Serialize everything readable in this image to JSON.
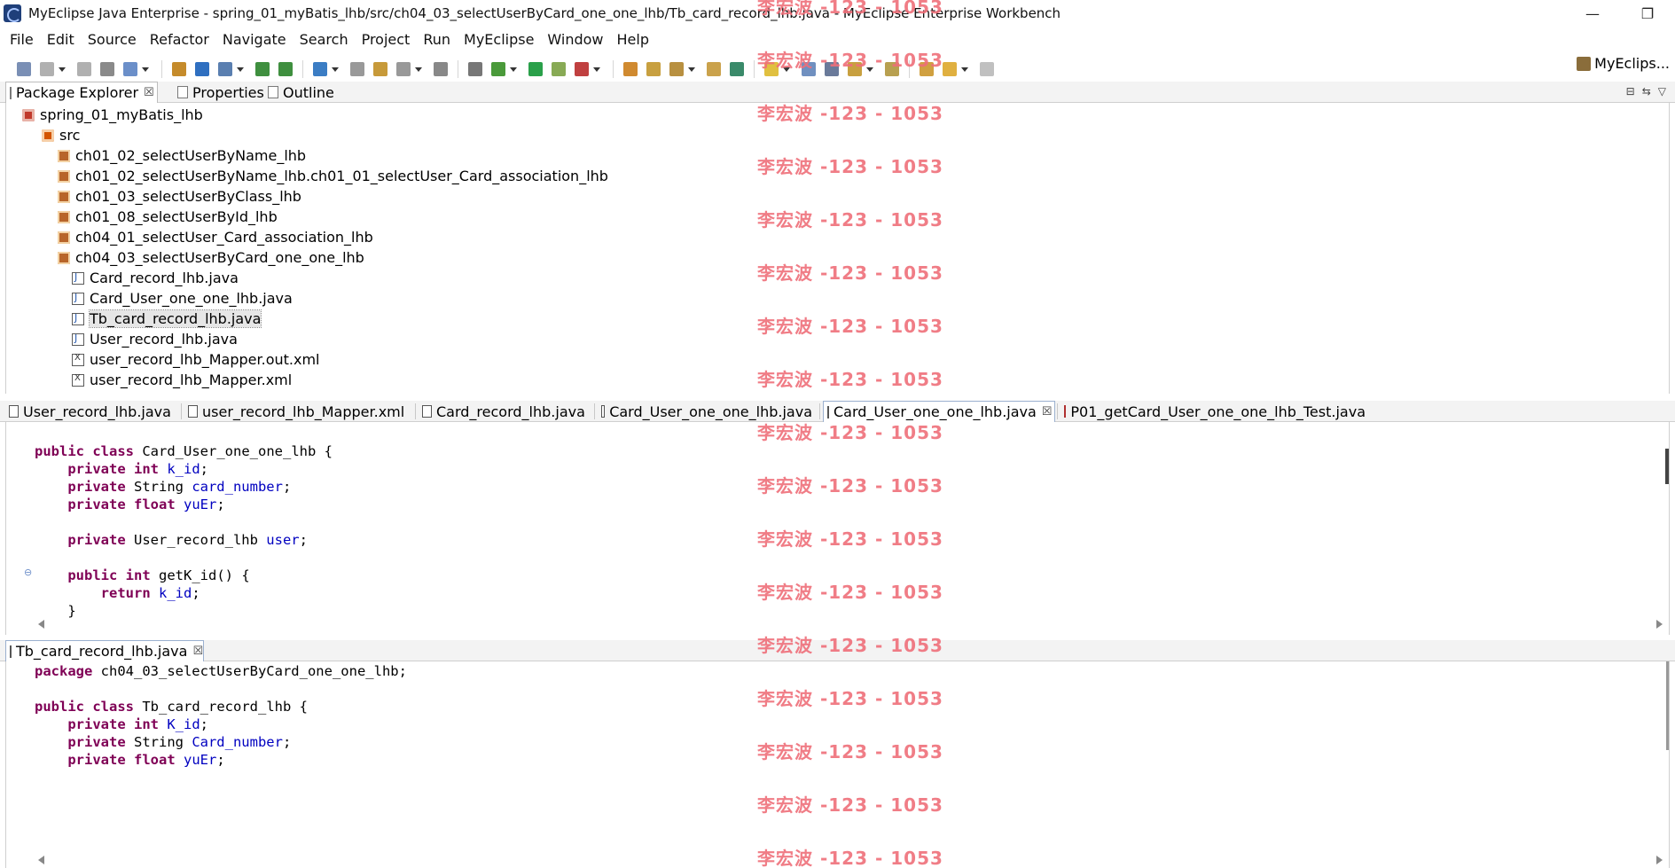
{
  "window": {
    "title": "MyEclipse Java Enterprise - spring_01_myBatis_lhb/src/ch04_03_selectUserByCard_one_one_lhb/Tb_card_record_lhb.java - MyEclipse Enterprise Workbench",
    "minimize": "—",
    "restore": "❐"
  },
  "menu": [
    "File",
    "Edit",
    "Source",
    "Refactor",
    "Navigate",
    "Search",
    "Project",
    "Run",
    "MyEclipse",
    "Window",
    "Help"
  ],
  "perspective": {
    "label": "MyEclips..."
  },
  "top_views": {
    "tabs": [
      {
        "label": "Package Explorer",
        "close": "☒",
        "active": true
      },
      {
        "label": "Properties"
      },
      {
        "label": "Outline"
      }
    ]
  },
  "tree": [
    {
      "label": "spring_01_myBatis_lhb",
      "icon": "project-icon",
      "level": 0
    },
    {
      "label": "src",
      "icon": "source-folder-icon",
      "level": 1
    },
    {
      "label": "ch01_02_selectUserByName_lhb",
      "icon": "package-icon",
      "level": 2
    },
    {
      "label": "ch01_02_selectUserByName_lhb.ch01_01_selectUser_Card_association_lhb",
      "icon": "package-icon",
      "level": 2
    },
    {
      "label": "ch01_03_selectUserByClass_lhb",
      "icon": "package-icon",
      "level": 2
    },
    {
      "label": "ch01_08_selectUserById_lhb",
      "icon": "package-icon",
      "level": 2
    },
    {
      "label": "ch04_01_selectUser_Card_association_lhb",
      "icon": "package-icon",
      "level": 2
    },
    {
      "label": "ch04_03_selectUserByCard_one_one_lhb",
      "icon": "package-icon",
      "level": 2
    },
    {
      "label": "Card_record_lhb.java",
      "icon": "java-file-icon",
      "level": 3
    },
    {
      "label": "Card_User_one_one_lhb.java",
      "icon": "java-file-icon",
      "level": 3
    },
    {
      "label": "Tb_card_record_lhb.java",
      "icon": "java-file-icon",
      "level": 3,
      "selected": true
    },
    {
      "label": "User_record_lhb.java",
      "icon": "java-file-icon",
      "level": 3
    },
    {
      "label": "user_record_lhb_Mapper.out.xml",
      "icon": "xml-file-icon",
      "level": 3
    },
    {
      "label": "user_record_lhb_Mapper.xml",
      "icon": "xml-file-icon",
      "level": 3
    }
  ],
  "editor_tabs": [
    {
      "label": "User_record_lhb.java",
      "type": "java"
    },
    {
      "label": "user_record_lhb_Mapper.xml",
      "type": "xml"
    },
    {
      "label": "Card_record_lhb.java",
      "type": "java"
    },
    {
      "label": "Card_User_one_one_lhb.java",
      "type": "java"
    },
    {
      "label": "Card_User_one_one_lhb.java",
      "type": "java",
      "active": true,
      "close": "☒"
    },
    {
      "label": "P01_getCard_User_one_one_lhb_Test.java",
      "type": "test"
    }
  ],
  "editor1": {
    "lines": [
      [
        {
          "t": "public",
          "c": "kw"
        },
        {
          "t": " "
        },
        {
          "t": "class",
          "c": "kw"
        },
        {
          "t": " Card_User_one_one_lhb {"
        }
      ],
      [
        {
          "t": "    "
        },
        {
          "t": "private",
          "c": "kw"
        },
        {
          "t": " "
        },
        {
          "t": "int",
          "c": "kw"
        },
        {
          "t": " "
        },
        {
          "t": "k_id",
          "c": "field"
        },
        {
          "t": ";"
        }
      ],
      [
        {
          "t": "    "
        },
        {
          "t": "private",
          "c": "kw"
        },
        {
          "t": " String "
        },
        {
          "t": "card_number",
          "c": "field"
        },
        {
          "t": ";"
        }
      ],
      [
        {
          "t": "    "
        },
        {
          "t": "private",
          "c": "kw"
        },
        {
          "t": " "
        },
        {
          "t": "float",
          "c": "kw"
        },
        {
          "t": " "
        },
        {
          "t": "yuEr",
          "c": "field"
        },
        {
          "t": ";"
        }
      ],
      [
        {
          "t": ""
        }
      ],
      [
        {
          "t": "    "
        },
        {
          "t": "private",
          "c": "kw"
        },
        {
          "t": " User_record_lhb "
        },
        {
          "t": "user",
          "c": "field"
        },
        {
          "t": ";"
        }
      ],
      [
        {
          "t": ""
        }
      ],
      [
        {
          "t": "    "
        },
        {
          "t": "public",
          "c": "kw"
        },
        {
          "t": " "
        },
        {
          "t": "int",
          "c": "kw"
        },
        {
          "t": " getK_id() {"
        }
      ],
      [
        {
          "t": "        "
        },
        {
          "t": "return",
          "c": "kw"
        },
        {
          "t": " "
        },
        {
          "t": "k_id",
          "c": "field"
        },
        {
          "t": ";"
        }
      ],
      [
        {
          "t": "    }"
        }
      ]
    ]
  },
  "editor2_tab": {
    "label": "Tb_card_record_lhb.java",
    "close": "☒"
  },
  "editor2": {
    "lines": [
      [
        {
          "t": "package",
          "c": "kw"
        },
        {
          "t": " ch04_03_selectUserByCard_one_one_lhb;"
        }
      ],
      [
        {
          "t": ""
        }
      ],
      [
        {
          "t": "public",
          "c": "kw"
        },
        {
          "t": " "
        },
        {
          "t": "class",
          "c": "kw"
        },
        {
          "t": " Tb_card_record_lhb {"
        }
      ],
      [
        {
          "t": "    "
        },
        {
          "t": "private",
          "c": "kw"
        },
        {
          "t": " "
        },
        {
          "t": "int",
          "c": "kw"
        },
        {
          "t": " "
        },
        {
          "t": "K_id",
          "c": "field"
        },
        {
          "t": ";"
        }
      ],
      [
        {
          "t": "    "
        },
        {
          "t": "private",
          "c": "kw"
        },
        {
          "t": " String "
        },
        {
          "t": "Card_number",
          "c": "field"
        },
        {
          "t": ";"
        }
      ],
      [
        {
          "t": "    "
        },
        {
          "t": "private",
          "c": "kw"
        },
        {
          "t": " "
        },
        {
          "t": "float",
          "c": "kw"
        },
        {
          "t": " "
        },
        {
          "t": "yuEr",
          "c": "field"
        },
        {
          "t": ";"
        }
      ]
    ]
  },
  "watermark": {
    "text": "李宏波 -123 - 1053",
    "color": "#ef6f7a",
    "count": 17
  },
  "colors": {
    "keyword": "#7f0055",
    "field": "#0000c0",
    "active_tab_border": "#9bb0cf"
  }
}
